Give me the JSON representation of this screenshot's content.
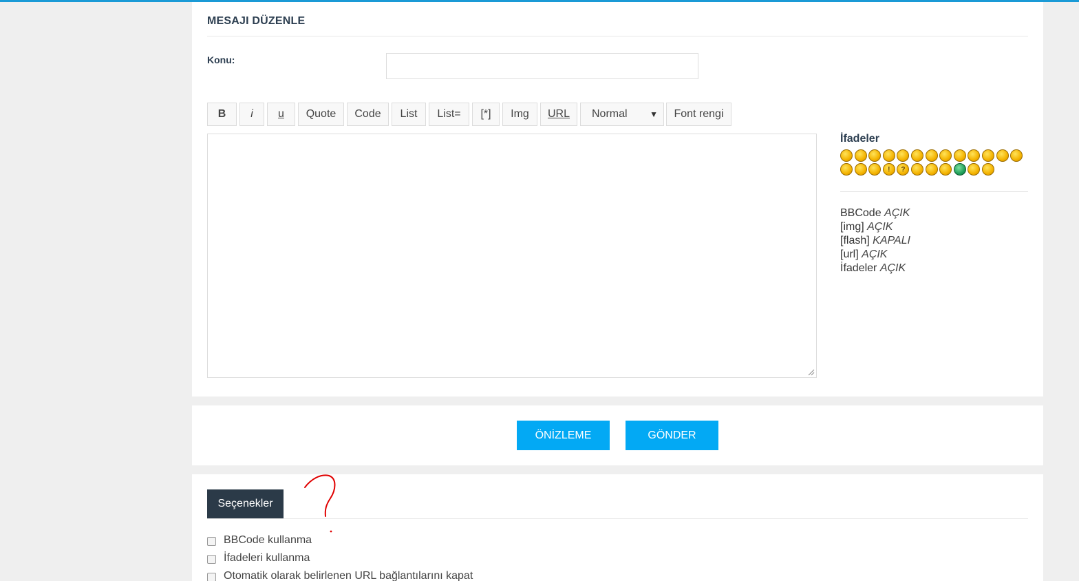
{
  "page": {
    "title": "MESAJI DÜZENLE",
    "subject_label": "Konu:",
    "subject_value": ""
  },
  "toolbar": {
    "bold": "B",
    "italic": "i",
    "underline": "u",
    "quote": "Quote",
    "code": "Code",
    "list": "List",
    "list_eq": "List=",
    "list_item": "[*]",
    "img": "Img",
    "url": "URL",
    "font_size": "Normal",
    "font_color": "Font rengi"
  },
  "editor": {
    "value": ""
  },
  "smilies": {
    "title": "İfadeler",
    "faces": [
      "😄",
      "😐",
      "😉",
      "😬",
      "😲",
      "😵",
      "😕",
      "😎",
      "😛",
      "😠",
      "😜",
      "😡",
      "😑",
      "😾",
      "😺",
      "😳",
      "!",
      "?",
      "💡",
      "➜",
      "😏",
      "😁",
      "🤓",
      "🤨"
    ]
  },
  "status": {
    "bbcode_label": "BBCode",
    "bbcode_value": "AÇIK",
    "img_label": "[img]",
    "img_value": "AÇIK",
    "flash_label": "[flash]",
    "flash_value": "KAPALI",
    "url_label": "[url]",
    "url_value": "AÇIK",
    "smilies_label": "İfadeler",
    "smilies_value": "AÇIK"
  },
  "actions": {
    "preview": "ÖNİZLEME",
    "submit": "GÖNDER"
  },
  "options": {
    "tab": "Seçenekler",
    "items": [
      "BBCode kullanma",
      "İfadeleri kullanma",
      "Otomatik olarak belirlenen URL bağlantılarını kapat"
    ]
  },
  "colors": {
    "accent": "#03a9f4",
    "tab_bg": "#2b3a48",
    "top_border": "#1a9ad6",
    "doodle": "#e00000"
  }
}
